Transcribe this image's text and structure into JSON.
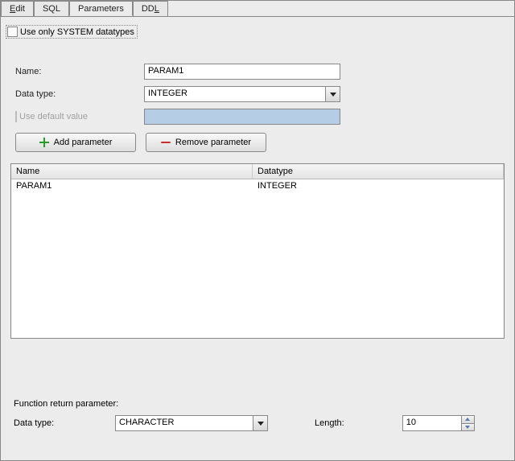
{
  "tabs": {
    "edit": "Edit",
    "sql": "SQL",
    "parameters": "Parameters",
    "ddl": "DDL"
  },
  "sysCheckbox": "Use only SYSTEM datatypes",
  "form": {
    "nameLabel": "Name:",
    "nameValue": "PARAM1",
    "dataTypeLabel": "Data type:",
    "dataTypeValue": "INTEGER",
    "defaultLabel": "Use default value",
    "addBtn": "Add parameter",
    "removeBtn": "Remove parameter"
  },
  "grid": {
    "headName": "Name",
    "headType": "Datatype",
    "rows": [
      {
        "name": "PARAM1",
        "type": "INTEGER"
      }
    ]
  },
  "ret": {
    "title": "Function return parameter:",
    "dataTypeLabel": "Data type:",
    "dataTypeValue": "CHARACTER",
    "lengthLabel": "Length:",
    "lengthValue": "10"
  }
}
